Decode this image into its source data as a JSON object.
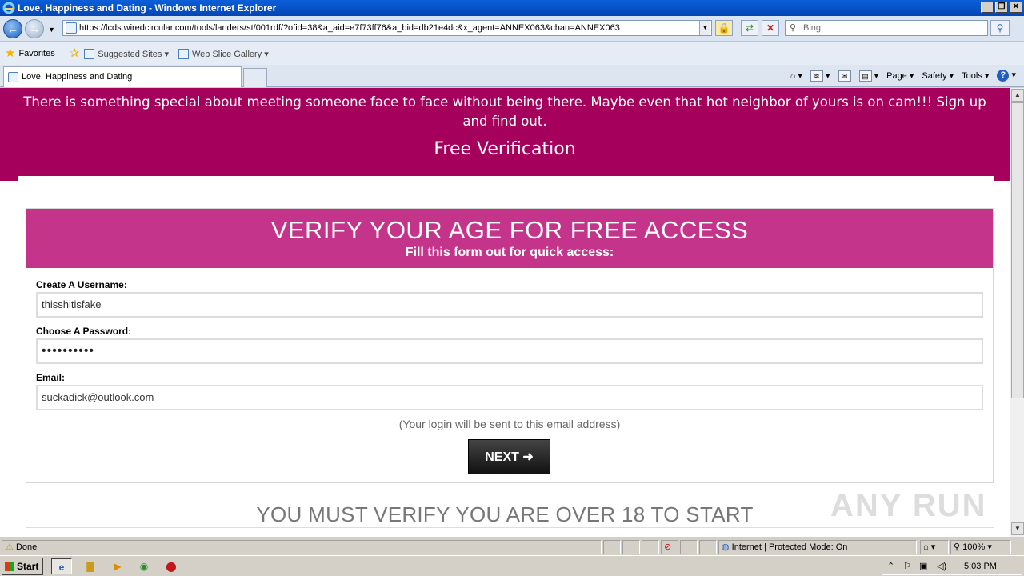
{
  "window": {
    "title": "Love, Happiness and Dating - Windows Internet Explorer",
    "buttons": {
      "minimize": "_",
      "maximize": "❐",
      "close": "✕"
    }
  },
  "addressbar": {
    "url": "https://lcds.wiredcircular.com/tools/landers/st/001rdf/?ofid=38&a_aid=e7f73ff76&a_bid=db21e4dc&x_agent=ANNEX063&chan=ANNEX063",
    "search_placeholder": "Bing"
  },
  "favorites": {
    "label": "Favorites",
    "items": [
      "Suggested Sites ▾",
      "Web Slice Gallery ▾"
    ]
  },
  "tabs": [
    {
      "label": "Love, Happiness and Dating"
    }
  ],
  "commandbar": {
    "page": "Page ▾",
    "safety": "Safety ▾",
    "tools": "Tools ▾",
    "help": "?"
  },
  "page": {
    "hero_text": "There is something special about meeting someone face to face without being there. Maybe even that hot neighbor of yours is on cam!!! Sign up and find out.",
    "hero_subtitle": "Free Verification",
    "form": {
      "heading": "VERIFY YOUR AGE FOR FREE ACCESS",
      "subheading": "Fill this form out for quick access:",
      "username_label": "Create A Username:",
      "username_value": "thisshitisfake",
      "password_label": "Choose A Password:",
      "password_value": "••••••••••",
      "email_label": "Email:",
      "email_value": "suckadick@outlook.com",
      "note": "(Your login will be sent to this email address)",
      "next_label": "NEXT ➜"
    },
    "bottom_text": "YOU MUST VERIFY YOU ARE OVER 18 TO START",
    "watermark": "ANY RUN"
  },
  "statusbar": {
    "status": "Done",
    "zone": "Internet | Protected Mode: On",
    "zoom": "100%"
  },
  "taskbar": {
    "start": "Start",
    "clock": "5:03 PM"
  },
  "colors": {
    "hero_bg": "#a5005b",
    "form_head_bg": "#c3348a"
  }
}
